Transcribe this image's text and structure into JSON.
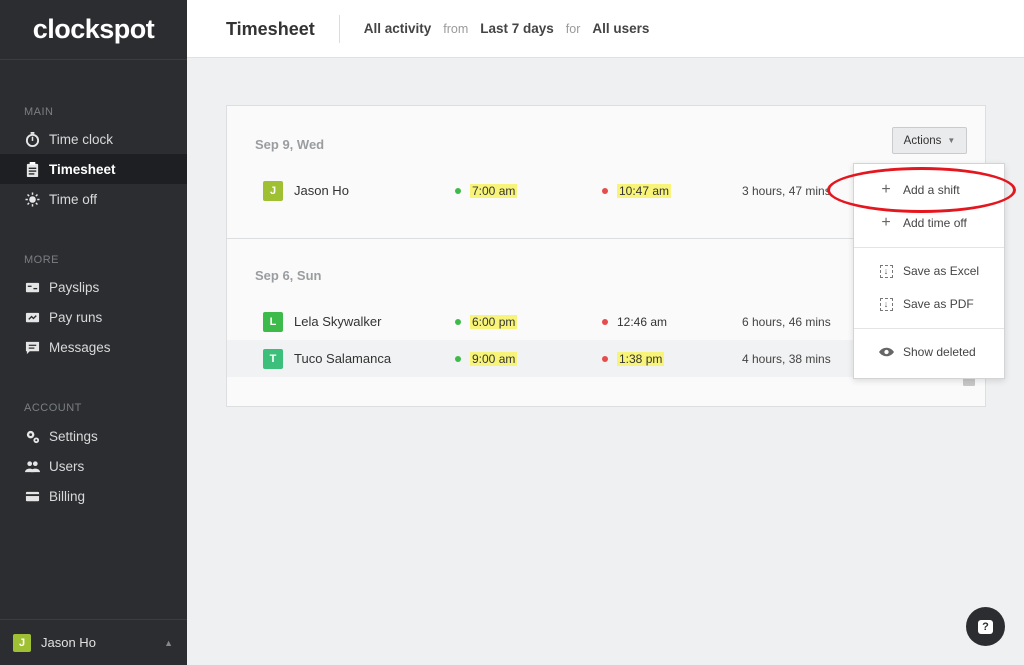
{
  "app": {
    "logo": "clockspot"
  },
  "sidebar": {
    "sections": [
      {
        "label": "MAIN",
        "items": [
          {
            "label": "Time clock",
            "icon": "stopwatch-icon"
          },
          {
            "label": "Timesheet",
            "icon": "clipboard-icon",
            "active": true
          },
          {
            "label": "Time off",
            "icon": "sun-icon"
          }
        ]
      },
      {
        "label": "MORE",
        "items": [
          {
            "label": "Payslips",
            "icon": "payslip-icon"
          },
          {
            "label": "Pay runs",
            "icon": "payrun-icon"
          },
          {
            "label": "Messages",
            "icon": "message-icon"
          }
        ]
      },
      {
        "label": "ACCOUNT",
        "items": [
          {
            "label": "Settings",
            "icon": "gears-icon"
          },
          {
            "label": "Users",
            "icon": "users-icon"
          },
          {
            "label": "Billing",
            "icon": "card-icon"
          }
        ]
      }
    ],
    "footer": {
      "avatar_letter": "J",
      "user_name": "Jason Ho"
    }
  },
  "header": {
    "title": "Timesheet",
    "filter_activity": "All activity",
    "from_label": "from",
    "filter_range": "Last 7 days",
    "for_label": "for",
    "filter_users": "All users"
  },
  "timesheet": {
    "actions_label": "Actions",
    "days": [
      {
        "date": "Sep 9, Wed",
        "entries": [
          {
            "letter": "J",
            "avatar_color": "#a0c033",
            "name": "Jason Ho",
            "clock_in": "7:00 am",
            "clock_in_highlight": true,
            "clock_out": "10:47 am",
            "clock_out_highlight": true,
            "duration": "3 hours, 47 mins"
          }
        ]
      },
      {
        "date": "Sep 6, Sun",
        "entries": [
          {
            "letter": "L",
            "avatar_color": "#3dbb4a",
            "name": "Lela Skywalker",
            "clock_in": "6:00 pm",
            "clock_in_highlight": true,
            "clock_out": "12:46 am",
            "clock_out_highlight": false,
            "duration": "6 hours, 46 mins"
          },
          {
            "letter": "T",
            "avatar_color": "#3cbf7a",
            "name": "Tuco Salamanca",
            "clock_in": "9:00 am",
            "clock_in_highlight": true,
            "clock_out": "1:38 pm",
            "clock_out_highlight": true,
            "duration": "4 hours, 38 mins"
          }
        ]
      }
    ]
  },
  "actions_menu": {
    "items": [
      {
        "label": "Add a shift",
        "icon": "plus-icon"
      },
      {
        "label": "Add time off",
        "icon": "plus-icon"
      },
      {
        "label": "Save as Excel",
        "icon": "download-icon"
      },
      {
        "label": "Save as PDF",
        "icon": "download-icon"
      },
      {
        "label": "Show deleted",
        "icon": "eye-icon"
      }
    ]
  },
  "colors": {
    "sidebar_bg": "#2b2d30",
    "highlight": "#f8f47a",
    "annotation": "#e4161e"
  }
}
